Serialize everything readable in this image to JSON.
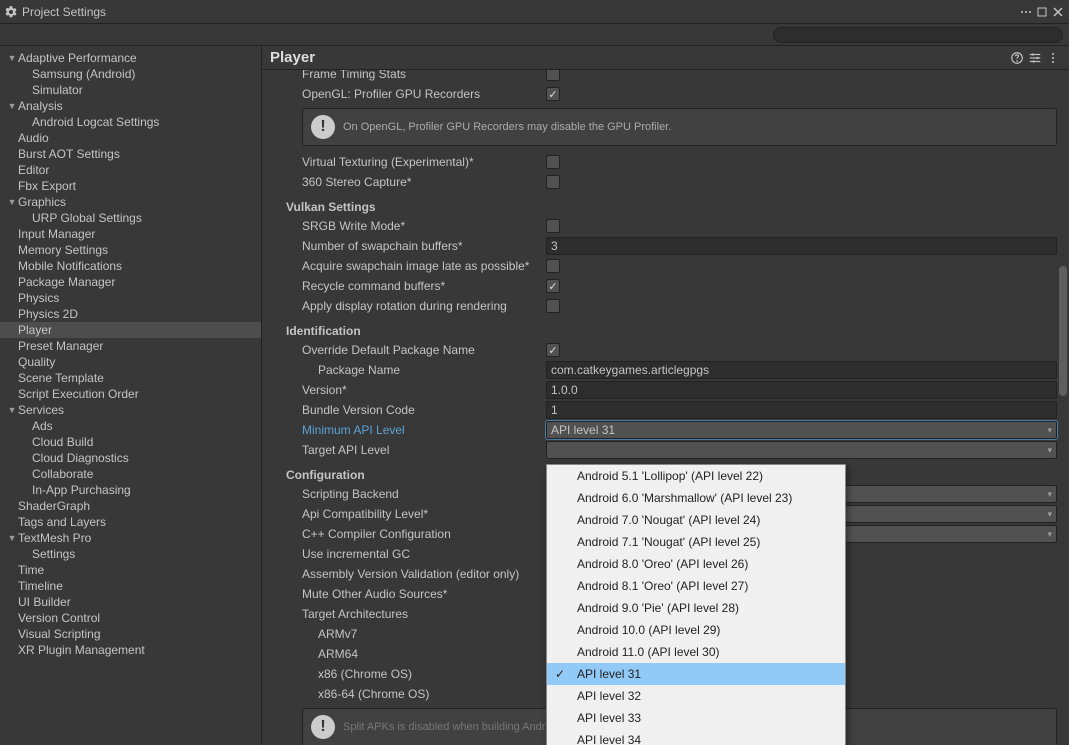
{
  "titlebar": {
    "title": "Project Settings"
  },
  "sidebar": [
    {
      "label": "Adaptive Performance",
      "indent": 0,
      "exp": true
    },
    {
      "label": "Samsung (Android)",
      "indent": 1,
      "exp": false
    },
    {
      "label": "Simulator",
      "indent": 1,
      "exp": false
    },
    {
      "label": "Analysis",
      "indent": 0,
      "exp": true
    },
    {
      "label": "Android Logcat Settings",
      "indent": 1,
      "exp": false
    },
    {
      "label": "Audio",
      "indent": 0,
      "exp": false
    },
    {
      "label": "Burst AOT Settings",
      "indent": 0,
      "exp": false
    },
    {
      "label": "Editor",
      "indent": 0,
      "exp": false
    },
    {
      "label": "Fbx Export",
      "indent": 0,
      "exp": false
    },
    {
      "label": "Graphics",
      "indent": 0,
      "exp": true
    },
    {
      "label": "URP Global Settings",
      "indent": 1,
      "exp": false
    },
    {
      "label": "Input Manager",
      "indent": 0,
      "exp": false
    },
    {
      "label": "Memory Settings",
      "indent": 0,
      "exp": false
    },
    {
      "label": "Mobile Notifications",
      "indent": 0,
      "exp": false
    },
    {
      "label": "Package Manager",
      "indent": 0,
      "exp": false
    },
    {
      "label": "Physics",
      "indent": 0,
      "exp": false
    },
    {
      "label": "Physics 2D",
      "indent": 0,
      "exp": false
    },
    {
      "label": "Player",
      "indent": 0,
      "exp": false,
      "active": true
    },
    {
      "label": "Preset Manager",
      "indent": 0,
      "exp": false
    },
    {
      "label": "Quality",
      "indent": 0,
      "exp": false
    },
    {
      "label": "Scene Template",
      "indent": 0,
      "exp": false
    },
    {
      "label": "Script Execution Order",
      "indent": 0,
      "exp": false
    },
    {
      "label": "Services",
      "indent": 0,
      "exp": true
    },
    {
      "label": "Ads",
      "indent": 1,
      "exp": false
    },
    {
      "label": "Cloud Build",
      "indent": 1,
      "exp": false
    },
    {
      "label": "Cloud Diagnostics",
      "indent": 1,
      "exp": false
    },
    {
      "label": "Collaborate",
      "indent": 1,
      "exp": false
    },
    {
      "label": "In-App Purchasing",
      "indent": 1,
      "exp": false
    },
    {
      "label": "ShaderGraph",
      "indent": 0,
      "exp": false
    },
    {
      "label": "Tags and Layers",
      "indent": 0,
      "exp": false
    },
    {
      "label": "TextMesh Pro",
      "indent": 0,
      "exp": true
    },
    {
      "label": "Settings",
      "indent": 1,
      "exp": false
    },
    {
      "label": "Time",
      "indent": 0,
      "exp": false
    },
    {
      "label": "Timeline",
      "indent": 0,
      "exp": false
    },
    {
      "label": "UI Builder",
      "indent": 0,
      "exp": false
    },
    {
      "label": "Version Control",
      "indent": 0,
      "exp": false
    },
    {
      "label": "Visual Scripting",
      "indent": 0,
      "exp": false
    },
    {
      "label": "XR Plugin Management",
      "indent": 0,
      "exp": false
    }
  ],
  "main": {
    "title": "Player",
    "rows_top": [
      {
        "label": "Frame Timing Stats",
        "type": "chk",
        "checked": false,
        "cut": true
      },
      {
        "label": "OpenGL: Profiler GPU Recorders",
        "type": "chk",
        "checked": true
      }
    ],
    "info1": "On OpenGL, Profiler GPU Recorders may disable the GPU Profiler.",
    "rows_top2": [
      {
        "label": "Virtual Texturing (Experimental)*",
        "type": "chk",
        "checked": false
      },
      {
        "label": "360 Stereo Capture*",
        "type": "chk",
        "checked": false
      }
    ],
    "section_vulkan": "Vulkan Settings",
    "vulkan": [
      {
        "label": "SRGB Write Mode*",
        "type": "chk",
        "checked": false
      },
      {
        "label": "Number of swapchain buffers*",
        "type": "text",
        "value": "3"
      },
      {
        "label": "Acquire swapchain image late as possible*",
        "type": "chk",
        "checked": false
      },
      {
        "label": "Recycle command buffers*",
        "type": "chk",
        "checked": true
      },
      {
        "label": "Apply display rotation during rendering",
        "type": "chk",
        "checked": false
      }
    ],
    "section_ident": "Identification",
    "ident": [
      {
        "label": "Override Default Package Name",
        "type": "chk",
        "checked": true
      },
      {
        "label": "Package Name",
        "type": "text",
        "value": "com.catkeygames.articlegpgs",
        "sub": true
      },
      {
        "label": "Version*",
        "type": "text",
        "value": "1.0.0"
      },
      {
        "label": "Bundle Version Code",
        "type": "text",
        "value": "1"
      },
      {
        "label": "Minimum API Level",
        "type": "dd",
        "value": "API level 31",
        "hl": true
      },
      {
        "label": "Target API Level",
        "type": "dd",
        "value": ""
      }
    ],
    "section_config": "Configuration",
    "config": [
      {
        "label": "Scripting Backend",
        "type": "dd",
        "value": ""
      },
      {
        "label": "Api Compatibility Level*",
        "type": "dd",
        "value": ""
      },
      {
        "label": "C++ Compiler Configuration",
        "type": "dd",
        "value": ""
      },
      {
        "label": "Use incremental GC",
        "type": "none"
      },
      {
        "label": "Assembly Version Validation (editor only)",
        "type": "none"
      },
      {
        "label": "Mute Other Audio Sources*",
        "type": "none"
      },
      {
        "label": "Target Architectures",
        "type": "none"
      },
      {
        "label": "ARMv7",
        "type": "none",
        "sub": true
      },
      {
        "label": "ARM64",
        "type": "none",
        "sub": true
      },
      {
        "label": "x86 (Chrome OS)",
        "type": "none",
        "sub": true
      },
      {
        "label": "x86-64 (Chrome OS)",
        "type": "none",
        "sub": true
      }
    ],
    "info2": "Split APKs is disabled when building Android A...",
    "dropdown": {
      "options": [
        "Android 5.1 'Lollipop' (API level 22)",
        "Android 6.0 'Marshmallow' (API level 23)",
        "Android 7.0 'Nougat' (API level 24)",
        "Android 7.1 'Nougat' (API level 25)",
        "Android 8.0 'Oreo' (API level 26)",
        "Android 8.1 'Oreo' (API level 27)",
        "Android 9.0 'Pie' (API level 28)",
        "Android 10.0 (API level 29)",
        "Android 11.0 (API level 30)",
        "API level 31",
        "API level 32",
        "API level 33",
        "API level 34"
      ],
      "selected_index": 9
    }
  }
}
